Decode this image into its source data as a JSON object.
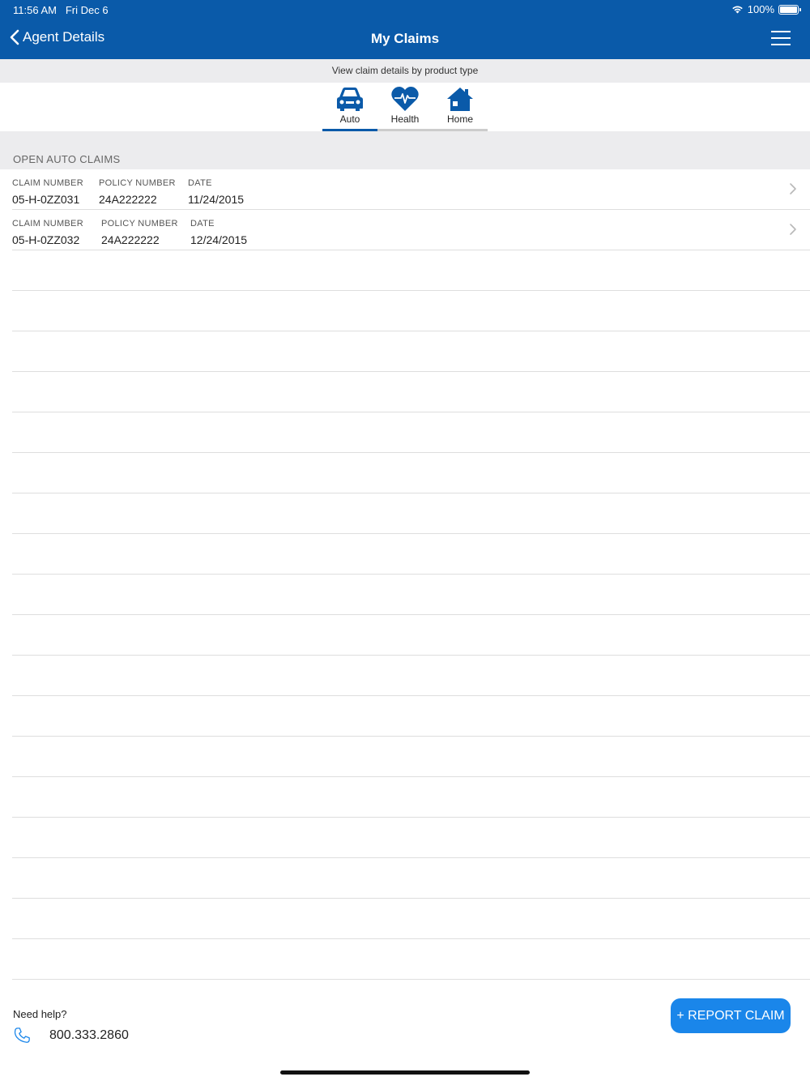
{
  "status_bar": {
    "time": "11:56 AM",
    "date": "Fri Dec 6",
    "battery": "100%",
    "battery_level": 1.0
  },
  "nav": {
    "back_label": "Agent Details",
    "title": "My Claims",
    "menu_icon": "hamburger-menu-icon",
    "back_icon": "chevron-left-icon"
  },
  "subheader": "View claim details by product type",
  "tabs": [
    {
      "label": "Auto",
      "icon": "car-icon",
      "active": true
    },
    {
      "label": "Health",
      "icon": "heart-pulse-icon",
      "active": false
    },
    {
      "label": "Home",
      "icon": "house-icon",
      "active": false
    }
  ],
  "section_title": "OPEN AUTO CLAIMS",
  "claims": [
    {
      "claim_header": "CLAIM NUMBER",
      "claim_number": "05-H-0ZZ031",
      "policy_header": "POLICY NUMBER",
      "policy_number": "24A222222",
      "date_header": "DATE",
      "date": "11/24/2015"
    },
    {
      "claim_header": "CLAIM NUMBER",
      "claim_number": "05-H-0ZZ032",
      "policy_header": "POLICY NUMBER",
      "policy_number": "24A222222",
      "date_header": "DATE",
      "date": "12/24/2015"
    }
  ],
  "footer": {
    "help_text": "Need help?",
    "phone": "800.333.2860",
    "report_button": "+ REPORT CLAIM"
  },
  "colors": {
    "brand": "#0a5aa9",
    "button": "#1a86ea",
    "band": "#ececee"
  }
}
